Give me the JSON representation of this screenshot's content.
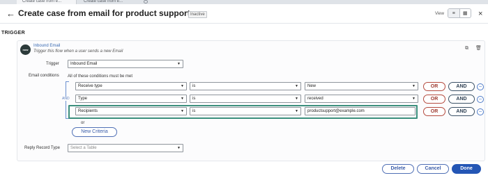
{
  "browser": {
    "tabs": [
      {
        "label": "Create case from e..."
      },
      {
        "label": "Create case from e..."
      }
    ]
  },
  "header": {
    "back_icon": "arrow-left-icon",
    "title": "Create case from email for product support",
    "status_badge": "Inactive",
    "view_label": "View",
    "view_options": [
      "tree-view-icon",
      "grid-view-icon"
    ],
    "close_icon": "close-icon"
  },
  "trigger": {
    "section_label": "TRIGGER",
    "avatar_text": "now",
    "name": "Inbound Email",
    "description": "Trigger this flow when a user sends a new Email",
    "trigger_label": "Trigger",
    "trigger_value": "Inbound Email",
    "email_conditions_label": "Email conditions",
    "conditions_hint": "All of these conditions must be met",
    "and_connector": "AND",
    "conditions": [
      {
        "field": "Receive type",
        "operator": "is",
        "value": "New",
        "value_is_dropdown": true
      },
      {
        "field": "Type",
        "operator": "is",
        "value": "received",
        "value_is_dropdown": true
      },
      {
        "field": "Recipients",
        "operator": "is",
        "value": "productsupport@example.com",
        "value_is_dropdown": false
      }
    ],
    "or_button": "OR",
    "and_button": "AND",
    "remove_icon": "minus-circle-icon",
    "or_separator": "or",
    "new_criteria_button": "New Criteria",
    "reply_record_type_label": "Reply Record Type",
    "reply_record_type_placeholder": "Select a Table"
  },
  "actions": {
    "delete": "Delete",
    "cancel": "Cancel",
    "done": "Done"
  },
  "colors": {
    "highlight": "#3b8f7d",
    "or_button": "#b44a3e",
    "done_button": "#2456b5",
    "link": "#3a6bb3"
  }
}
